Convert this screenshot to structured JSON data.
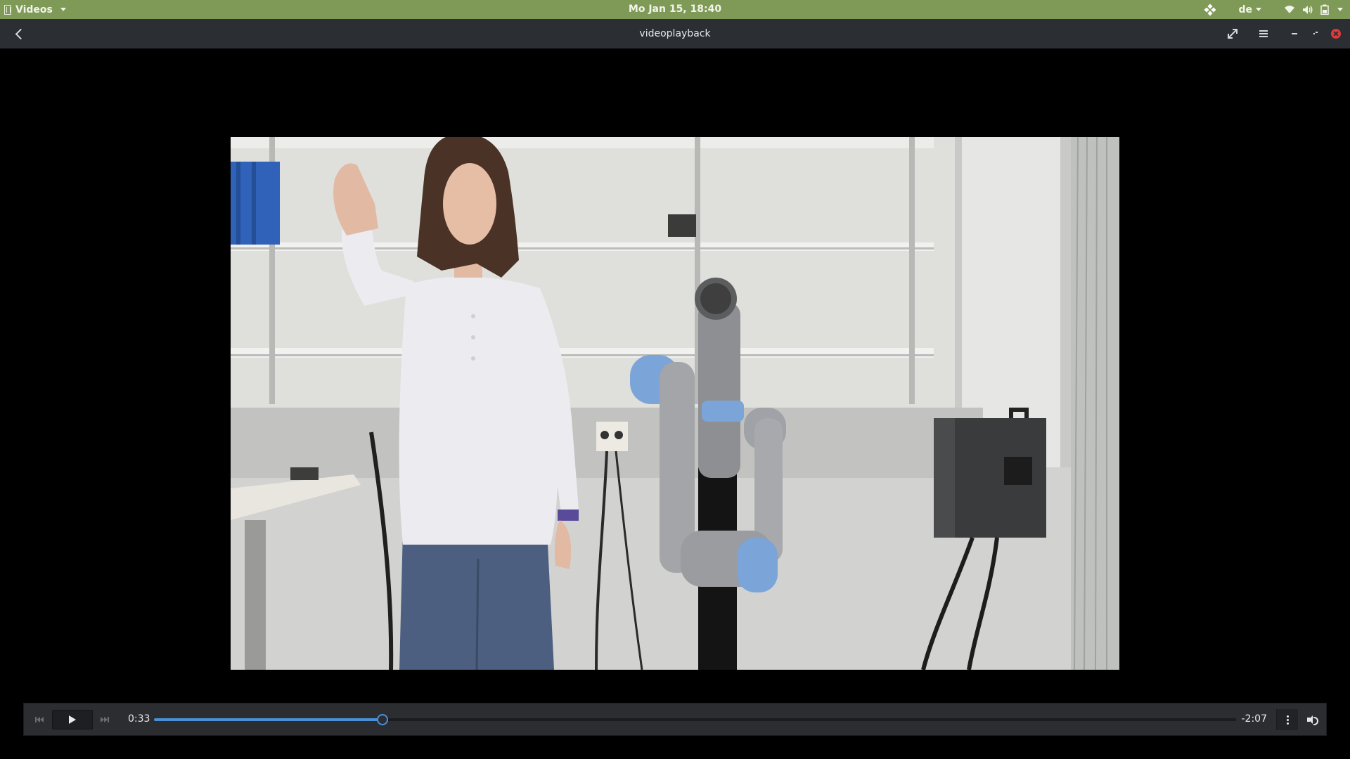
{
  "topbar": {
    "app_menu": "Videos",
    "clock": "Mo Jan 15, 18:40",
    "language": "de",
    "icons": [
      "dropbox-icon",
      "wifi-icon",
      "volume-icon",
      "battery-icon"
    ],
    "accent_color": "#7f9a57"
  },
  "headerbar": {
    "title": "videoplayback",
    "buttons": [
      "back-button",
      "fullscreen-button",
      "menu-button",
      "minimize-button",
      "restore-button",
      "close-button"
    ]
  },
  "video": {
    "description_icon": "video-frame"
  },
  "controls": {
    "current_time": "0:33",
    "remaining_time": "-2:07",
    "progress_fraction": 0.211,
    "accent_color": "#4a90d9"
  }
}
